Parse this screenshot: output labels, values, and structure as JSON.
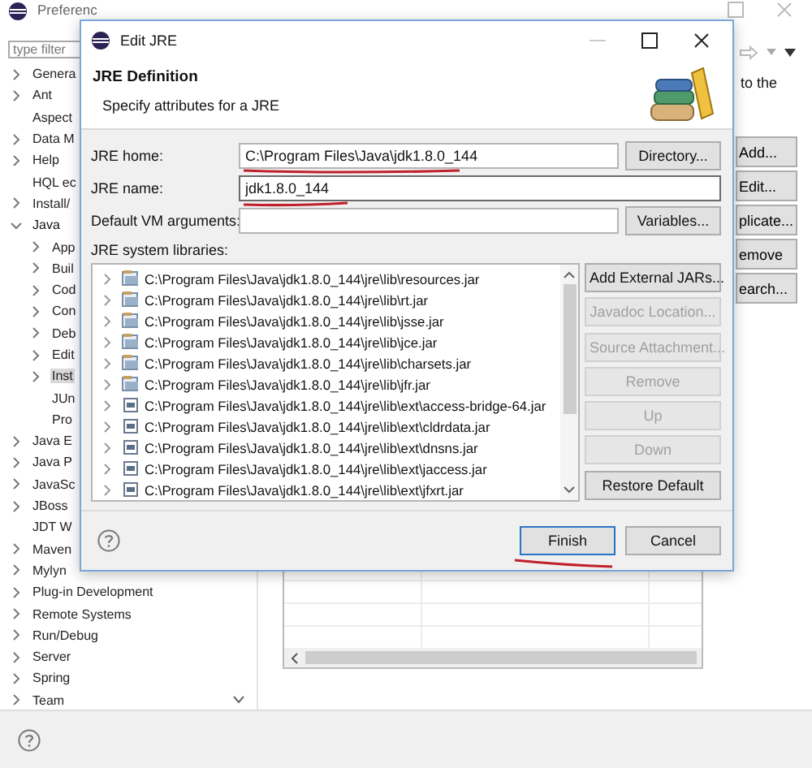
{
  "preferences": {
    "title": "Preferenc",
    "filter_placeholder": "type filter",
    "tree": [
      {
        "label": "Genera",
        "expandable": true,
        "expanded": false,
        "selected": false
      },
      {
        "label": "Ant",
        "expandable": true,
        "expanded": false,
        "selected": false
      },
      {
        "label": "Aspect",
        "expandable": false,
        "expanded": false,
        "selected": false
      },
      {
        "label": "Data M",
        "expandable": true,
        "expanded": false,
        "selected": false
      },
      {
        "label": "Help",
        "expandable": true,
        "expanded": false,
        "selected": false
      },
      {
        "label": "HQL ec",
        "expandable": false,
        "expanded": false,
        "selected": false
      },
      {
        "label": "Install/",
        "expandable": true,
        "expanded": false,
        "selected": false
      },
      {
        "label": "Java",
        "expandable": true,
        "expanded": true,
        "selected": false,
        "children": [
          {
            "label": "App",
            "expandable": true,
            "expanded": false,
            "selected": false
          },
          {
            "label": "Buil",
            "expandable": true,
            "expanded": false,
            "selected": false
          },
          {
            "label": "Cod",
            "expandable": true,
            "expanded": false,
            "selected": false
          },
          {
            "label": "Con",
            "expandable": true,
            "expanded": false,
            "selected": false
          },
          {
            "label": "Deb",
            "expandable": true,
            "expanded": false,
            "selected": false
          },
          {
            "label": "Edit",
            "expandable": true,
            "expanded": false,
            "selected": false
          },
          {
            "label": "Inst",
            "expandable": true,
            "expanded": false,
            "selected": true
          },
          {
            "label": "JUn",
            "expandable": false,
            "expanded": false,
            "selected": false
          },
          {
            "label": "Pro",
            "expandable": false,
            "expanded": false,
            "selected": false
          }
        ]
      },
      {
        "label": "Java E",
        "expandable": true,
        "expanded": false,
        "selected": false
      },
      {
        "label": "Java P",
        "expandable": true,
        "expanded": false,
        "selected": false
      },
      {
        "label": "JavaSc",
        "expandable": true,
        "expanded": false,
        "selected": false
      },
      {
        "label": "JBoss",
        "expandable": true,
        "expanded": false,
        "selected": false
      },
      {
        "label": "JDT W",
        "expandable": false,
        "expanded": false,
        "selected": false
      },
      {
        "label": "Maven",
        "expandable": true,
        "expanded": false,
        "selected": false
      },
      {
        "label": "Mylyn",
        "expandable": true,
        "expanded": false,
        "selected": false
      },
      {
        "label": "Plug-in Development",
        "expandable": true,
        "expanded": false,
        "selected": false
      },
      {
        "label": "Remote Systems",
        "expandable": true,
        "expanded": false,
        "selected": false
      },
      {
        "label": "Run/Debug",
        "expandable": true,
        "expanded": false,
        "selected": false
      },
      {
        "label": "Server",
        "expandable": true,
        "expanded": false,
        "selected": false
      },
      {
        "label": "Spring",
        "expandable": true,
        "expanded": false,
        "selected": false
      },
      {
        "label": "Team",
        "expandable": true,
        "expanded": false,
        "selected": false
      }
    ],
    "description": "to the",
    "buttons": [
      "Add...",
      "Edit...",
      "plicate...",
      "emove",
      "earch..."
    ]
  },
  "dialog": {
    "title": "Edit JRE",
    "heading": "JRE Definition",
    "description": "Specify attributes for a JRE",
    "fields": [
      {
        "label": "JRE home:",
        "value": "C:\\Program Files\\Java\\jdk1.8.0_144",
        "button": "Directory...",
        "focused": false,
        "underlined": true
      },
      {
        "label": "JRE name:",
        "value": "jdk1.8.0_144",
        "focused": true,
        "underlined": true
      },
      {
        "label": "Default VM arguments:",
        "button": "Variables...",
        "focused": false,
        "underlined": false
      }
    ],
    "libraries_label": "JRE system libraries:",
    "libraries": [
      {
        "kind": "jar",
        "path": "C:\\Program Files\\Java\\jdk1.8.0_144\\jre\\lib\\resources.jar"
      },
      {
        "kind": "jar",
        "path": "C:\\Program Files\\Java\\jdk1.8.0_144\\jre\\lib\\rt.jar"
      },
      {
        "kind": "jar",
        "path": "C:\\Program Files\\Java\\jdk1.8.0_144\\jre\\lib\\jsse.jar"
      },
      {
        "kind": "jar",
        "path": "C:\\Program Files\\Java\\jdk1.8.0_144\\jre\\lib\\jce.jar"
      },
      {
        "kind": "jar",
        "path": "C:\\Program Files\\Java\\jdk1.8.0_144\\jre\\lib\\charsets.jar"
      },
      {
        "kind": "jar",
        "path": "C:\\Program Files\\Java\\jdk1.8.0_144\\jre\\lib\\jfr.jar"
      },
      {
        "kind": "ext",
        "path": "C:\\Program Files\\Java\\jdk1.8.0_144\\jre\\lib\\ext\\access-bridge-64.jar"
      },
      {
        "kind": "ext",
        "path": "C:\\Program Files\\Java\\jdk1.8.0_144\\jre\\lib\\ext\\cldrdata.jar"
      },
      {
        "kind": "ext",
        "path": "C:\\Program Files\\Java\\jdk1.8.0_144\\jre\\lib\\ext\\dnsns.jar"
      },
      {
        "kind": "ext",
        "path": "C:\\Program Files\\Java\\jdk1.8.0_144\\jre\\lib\\ext\\jaccess.jar"
      },
      {
        "kind": "ext",
        "path": "C:\\Program Files\\Java\\jdk1.8.0_144\\jre\\lib\\ext\\jfxrt.jar"
      }
    ],
    "library_buttons": [
      {
        "label": "Add External JARs...",
        "disabled": false
      },
      {
        "label": "Javadoc Location...",
        "disabled": true
      },
      {
        "label": "Source Attachment...",
        "disabled": true
      },
      {
        "label": "Remove",
        "disabled": true
      },
      {
        "label": "Up",
        "disabled": true
      },
      {
        "label": "Down",
        "disabled": true
      },
      {
        "label": "Restore Default",
        "disabled": false
      }
    ],
    "footer_buttons": [
      {
        "label": "Finish",
        "default": true,
        "underlined": true
      },
      {
        "label": "Cancel",
        "default": false,
        "underlined": false
      }
    ]
  }
}
